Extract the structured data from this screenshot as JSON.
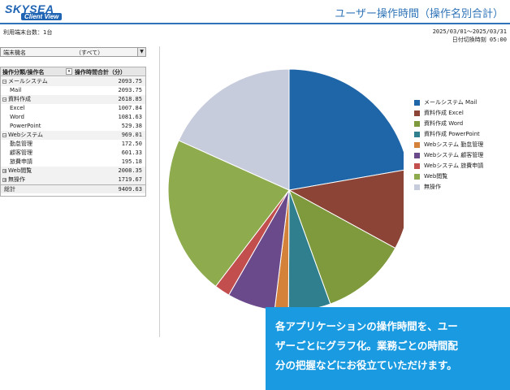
{
  "brand": {
    "name": "SKYSEA",
    "sub": "Client View"
  },
  "page_title": "ユーザー操作時間（操作名別合計）",
  "meta": {
    "terminals": "利用端末台数：1台",
    "date_range": "2025/03/01～2025/03/31",
    "cutoff": "日付切換時刻 05:00"
  },
  "filter": {
    "label": "端末機名",
    "value": "（すべて）"
  },
  "table": {
    "col_name": "操作分類/操作名",
    "col_value": "操作時間合計（分）",
    "rows": [
      {
        "name": "メールシステム",
        "value": "2093.75",
        "type": "grp",
        "toggle": "−"
      },
      {
        "name": "Mail",
        "value": "2093.75",
        "type": "child"
      },
      {
        "name": "資料作成",
        "value": "2618.85",
        "type": "grp",
        "toggle": "−"
      },
      {
        "name": "Excel",
        "value": "1007.84",
        "type": "child"
      },
      {
        "name": "Word",
        "value": "1081.63",
        "type": "child"
      },
      {
        "name": "PowerPoint",
        "value": "529.38",
        "type": "child"
      },
      {
        "name": "Webシステム",
        "value": "969.01",
        "type": "grp",
        "toggle": "−"
      },
      {
        "name": "勤怠管理",
        "value": "172.50",
        "type": "child"
      },
      {
        "name": "顧客管理",
        "value": "601.33",
        "type": "child"
      },
      {
        "name": "旅費申請",
        "value": "195.18",
        "type": "child"
      },
      {
        "name": "Web閲覧",
        "value": "2008.35",
        "type": "grp",
        "toggle": "+"
      },
      {
        "name": "無操作",
        "value": "1719.67",
        "type": "grp",
        "toggle": "+"
      },
      {
        "name": "総計",
        "value": "9409.63",
        "type": "total"
      }
    ]
  },
  "chart_data": {
    "type": "pie",
    "slices": [
      {
        "label": "メールシステム Mail",
        "value": 2093.75,
        "color": "#1f66a8"
      },
      {
        "label": "資料作成 Excel",
        "value": 1007.84,
        "color": "#8c4436"
      },
      {
        "label": "資料作成 Word",
        "value": 1081.63,
        "color": "#7e9a3c"
      },
      {
        "label": "資料作成 PowerPoint",
        "value": 529.38,
        "color": "#2f7f8e"
      },
      {
        "label": "Webシステム 勤怠管理",
        "value": 172.5,
        "color": "#d4823a"
      },
      {
        "label": "Webシステム 顧客管理",
        "value": 601.33,
        "color": "#6b4a8c"
      },
      {
        "label": "Webシステム 旅費申請",
        "value": 195.18,
        "color": "#c24e4e"
      },
      {
        "label": "Web閲覧",
        "value": 2008.35,
        "color": "#8eab4e"
      },
      {
        "label": "無操作",
        "value": 1719.67,
        "color": "#c7ccdc"
      }
    ],
    "legend_position": "right"
  },
  "callout": {
    "lines": [
      "各アプリケーションの操作時間を、ユー",
      "ザーごとにグラフ化。業務ごとの時間配",
      "分の把握などにお役立ていただけます。"
    ]
  }
}
